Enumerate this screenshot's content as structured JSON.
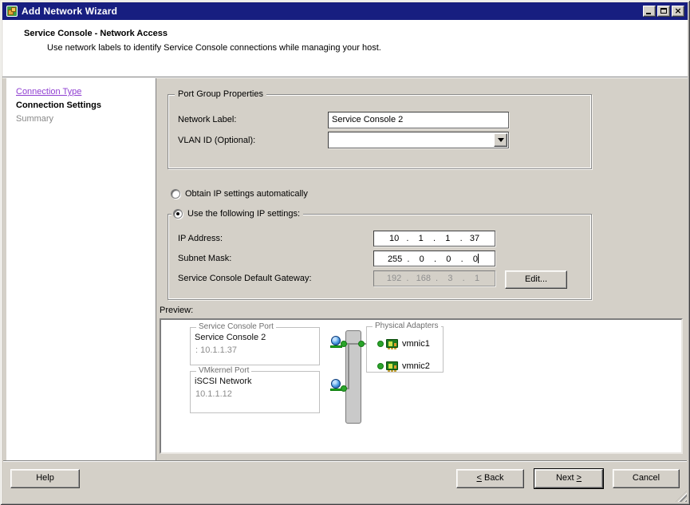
{
  "window": {
    "title": "Add Network Wizard"
  },
  "titlebar_buttons": {
    "minimize": "minimize",
    "maximize": "maximize",
    "close": "x"
  },
  "header": {
    "title": "Service Console - Network Access",
    "subtitle": "Use network labels to identify Service Console connections while managing your host."
  },
  "sidebar": {
    "items": [
      {
        "label": "Connection Type",
        "state": "visited-link"
      },
      {
        "label": "Connection Settings",
        "state": "current"
      },
      {
        "label": "Summary",
        "state": "disabled"
      }
    ]
  },
  "port_group_properties": {
    "legend": "Port Group Properties",
    "network_label": {
      "label": "Network Label:",
      "value": "Service Console 2"
    },
    "vlan_id": {
      "label": "VLAN ID (Optional):",
      "value": ""
    }
  },
  "ip_settings": {
    "obtain_auto": {
      "label": "Obtain IP settings automatically",
      "selected": false
    },
    "use_following": {
      "label": "Use the following IP settings:",
      "selected": true
    },
    "ip_address": {
      "label": "IP Address:",
      "value": " 10   .    1    .    1    .   37"
    },
    "subnet_mask": {
      "label": "Subnet Mask:",
      "value": "255  .    0    .    0    .    0"
    },
    "gateway": {
      "label": "Service Console Default Gateway:",
      "value": "192  .   168  .    3    .    1"
    },
    "edit_button": "Edit..."
  },
  "preview": {
    "label": "Preview:",
    "service_console_port": {
      "legend": "Service Console Port",
      "name": "Service Console 2",
      "ip": ": 10.1.1.37"
    },
    "vmkernel_port": {
      "legend": "VMkernel Port",
      "name": "iSCSI Network",
      "ip": "10.1.1.12"
    },
    "physical_adapters": {
      "legend": "Physical Adapters",
      "adapters": [
        "vmnic1",
        "vmnic2"
      ]
    }
  },
  "footer": {
    "help": "Help",
    "back_accel": "<",
    "back_text": " Back",
    "next_text": "Next ",
    "next_accel": ">",
    "cancel": "Cancel"
  },
  "colors": {
    "titlebar": "#171e80",
    "dialog_bg": "#d4d0c8",
    "visited_link": "#8f3fd1",
    "connector_green": "#2aa52a"
  }
}
